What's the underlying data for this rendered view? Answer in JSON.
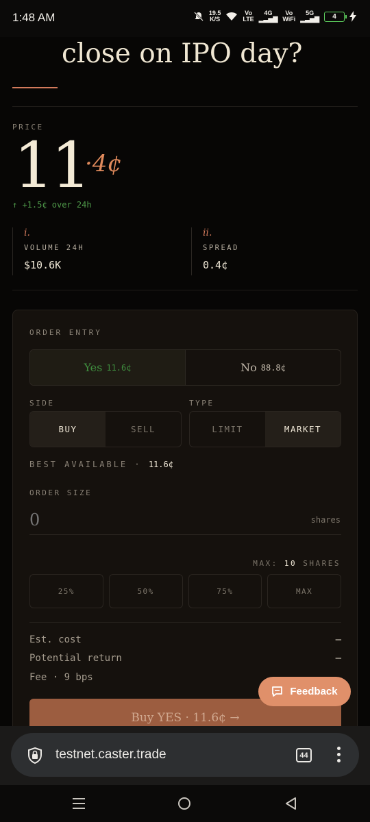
{
  "status_bar": {
    "time": "1:48 AM",
    "net_speed_top": "19.5",
    "net_speed_bottom": "K/S",
    "volte1_top": "Vo",
    "volte1_bottom": "LTE",
    "sig1": "4G",
    "volte2_top": "Vo",
    "volte2_bottom": "WiFi",
    "sig2": "5G",
    "battery": "4",
    "battery_color": "#5fd35f"
  },
  "market": {
    "title": "close on IPO day?"
  },
  "price": {
    "label": "PRICE",
    "whole": "11",
    "decimal": "·4¢",
    "change": "↑ +1.5¢ over 24h"
  },
  "stats": [
    {
      "num": "i.",
      "label": "VOLUME 24H",
      "value": "$10.6K"
    },
    {
      "num": "ii.",
      "label": "SPREAD",
      "value": "0.4¢"
    }
  ],
  "order": {
    "title": "ORDER ENTRY",
    "outcomes": [
      {
        "name": "Yes",
        "price": "11.6¢"
      },
      {
        "name": "No",
        "price": "88.8¢"
      }
    ],
    "side_label": "SIDE",
    "side_options": [
      "BUY",
      "SELL"
    ],
    "type_label": "TYPE",
    "type_options": [
      "LIMIT",
      "MARKET"
    ],
    "best_label": "BEST AVAILABLE ·",
    "best_value": "11.6¢",
    "size_label": "ORDER SIZE",
    "size_placeholder": "0",
    "size_unit": "shares",
    "max_label": "MAX:",
    "max_value": "10",
    "max_unit": "SHARES",
    "pct_buttons": [
      "25%",
      "50%",
      "75%",
      "MAX"
    ],
    "est_cost_label": "Est. cost",
    "est_cost_value": "–",
    "return_label": "Potential return",
    "return_value": "–",
    "fee_label": "Fee · 9 bps",
    "submit_label": "Buy YES · 11.6¢ →"
  },
  "feedback": {
    "label": "Feedback"
  },
  "browser": {
    "url": "testnet.caster.trade",
    "tab_count": "44"
  },
  "colors": {
    "accent": "#d27a5c",
    "yes_green": "#3f8e3f",
    "feedback_bg": "#e0906a"
  }
}
